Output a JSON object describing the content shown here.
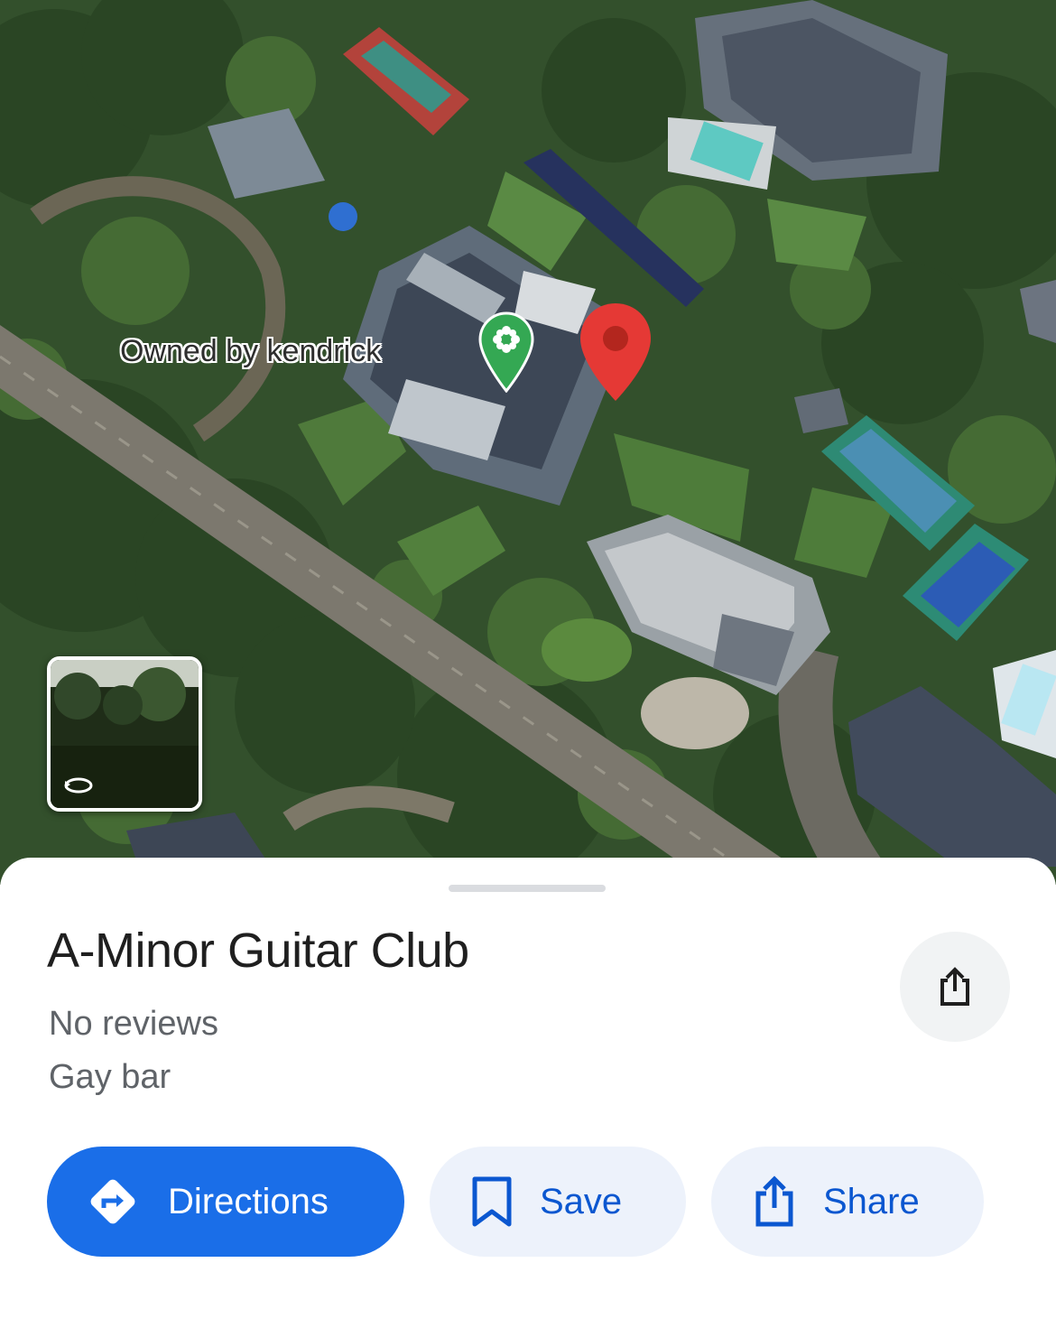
{
  "map": {
    "poi_label": "Owned by kendrick",
    "poi_icon": "flower-icon",
    "poi_color": "#34a853",
    "pin_color": "#e53935",
    "streetview_icon": "rotate-360-icon"
  },
  "place": {
    "title": "A-Minor Guitar Club",
    "reviews": "No reviews",
    "category": "Gay bar"
  },
  "actions": {
    "share_icon": "share-icon",
    "directions_label": "Directions",
    "directions_icon": "directions-icon",
    "save_label": "Save",
    "save_icon": "bookmark-icon",
    "share_label": "Share"
  },
  "colors": {
    "primary": "#1a6ee8",
    "button_text": "#0b57d0",
    "secondary_bg": "#edf2fb",
    "subtext": "#5f6368"
  }
}
